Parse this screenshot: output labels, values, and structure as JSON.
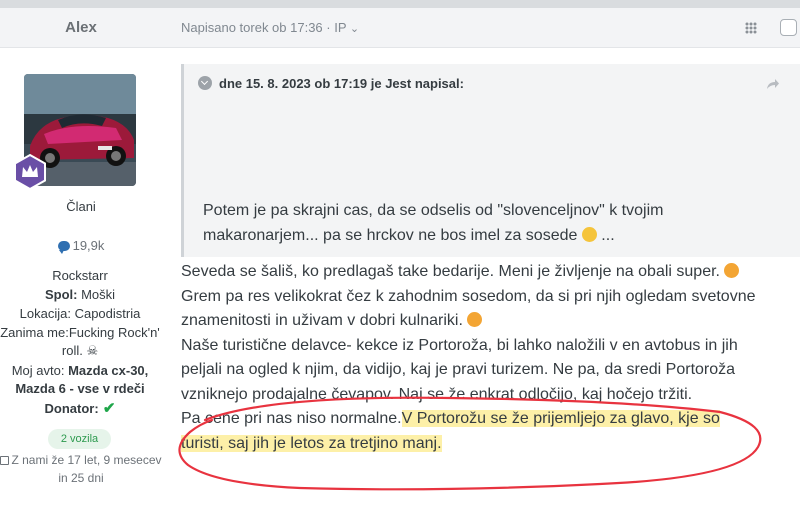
{
  "header": {
    "author": "Alex",
    "posted": "Napisano torek ob 17:36 · IP",
    "posted_caret": "⌄"
  },
  "icons": {
    "share": "share-icon",
    "select": "checkbox-icon",
    "crown": "crown-badge-icon",
    "reputation": "chat-bubble-icon",
    "calendar": "calendar-icon",
    "quote_toggle": "chevron-down-icon",
    "quote_jump": "share-arrow-icon"
  },
  "sidebar": {
    "group": "Člani",
    "reputation": "19,9k",
    "username": "Rockstarr",
    "fields": [
      {
        "label": "Spol:",
        "value": " Moški"
      },
      {
        "label": "Lokacija:",
        "value": " Capodistria"
      },
      {
        "label": "Zanima me:",
        "value": "Fucking Rock'n' roll. ☠"
      },
      {
        "label": "Moj avto:",
        "value": " Mazda cx-30, Mazda 6 - vse v rdeči"
      },
      {
        "label": "Donator:",
        "value": " ✔"
      }
    ],
    "vehicles_pill": "2 vozila",
    "joined": "Z nami že 17 let, 9 mesecev in 25 dni"
  },
  "quote": {
    "header": "dne 15. 8. 2023 ob 17:19 je Jest napisal:",
    "lines": [
      "Potem je pa skrajni cas, da se odselis od \"slovenceljnov\" k tvojim",
      "makaronarjem... pa se hrckov ne bos imel za sosede",
      " ..."
    ]
  },
  "post": {
    "lines": [
      "Seveda se šališ, ko predlagaš take bedarije. Meni  je življenje na obali super. ",
      "Grem pa res velikokrat čez k zahodnim sosedom, da si pri njih ogledam svetovne",
      "znamenitosti in uživam v dobri kulnariki. ",
      "Naše  turistične delavce- kekce iz Portoroža, bi lahko naložili v en avtobus in jih",
      "peljali na ogled k njim, da vidijo, kaj je  pravi turizem. Ne pa, da sredi Portoroža",
      "vzniknejo prodajalne čevapov. Naj se že enkrat odločijo, kaj hočejo tržiti."
    ],
    "line7_plain": "Pa cene pri nas niso normalne.",
    "line7_highlight": "V Portorožu se že prijemljejo za glavo, kje so",
    "line8_highlight": "turisti, saj jih je letos za tretjino manj."
  },
  "colors": {
    "highlight": "#fdf0a8",
    "annotation": "#e8333f",
    "badge": "#6a4fa6",
    "pill_bg": "#e6f4ea",
    "pill_text": "#2d9a4f"
  }
}
